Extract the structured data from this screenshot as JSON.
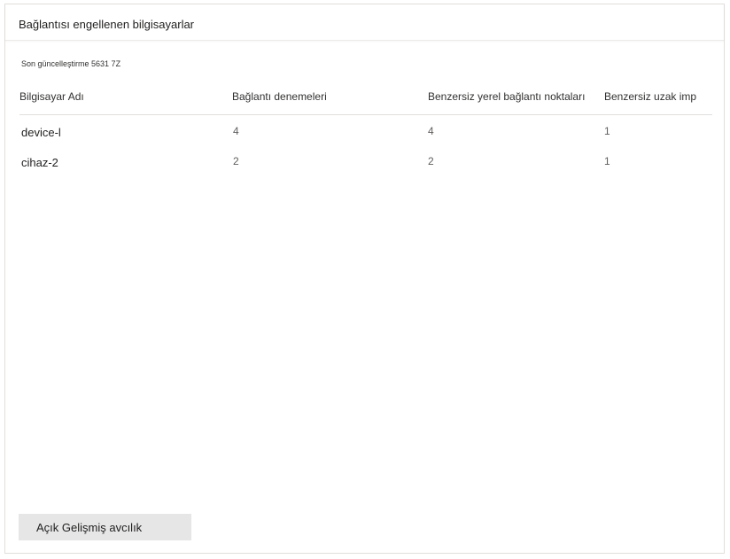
{
  "card": {
    "title": "Bağlantısı engellenen bilgisayarlar",
    "last_updated": "Son güncelleştirme 5631 7Z"
  },
  "table": {
    "headers": [
      "Bilgisayar Adı",
      "Bağlantı denemeleri",
      "Benzersiz yerel bağlantı noktaları",
      "Benzersiz uzak imp"
    ],
    "rows": [
      [
        "device-l",
        "4",
        "4",
        "1"
      ],
      [
        "cihaz-2",
        "2",
        "2",
        "1"
      ]
    ]
  },
  "footer": {
    "button_label": "Açık Gelişmiş avcılık"
  },
  "colors": {
    "button_background": "#e6e6e6",
    "border": "#e1dfdd"
  }
}
